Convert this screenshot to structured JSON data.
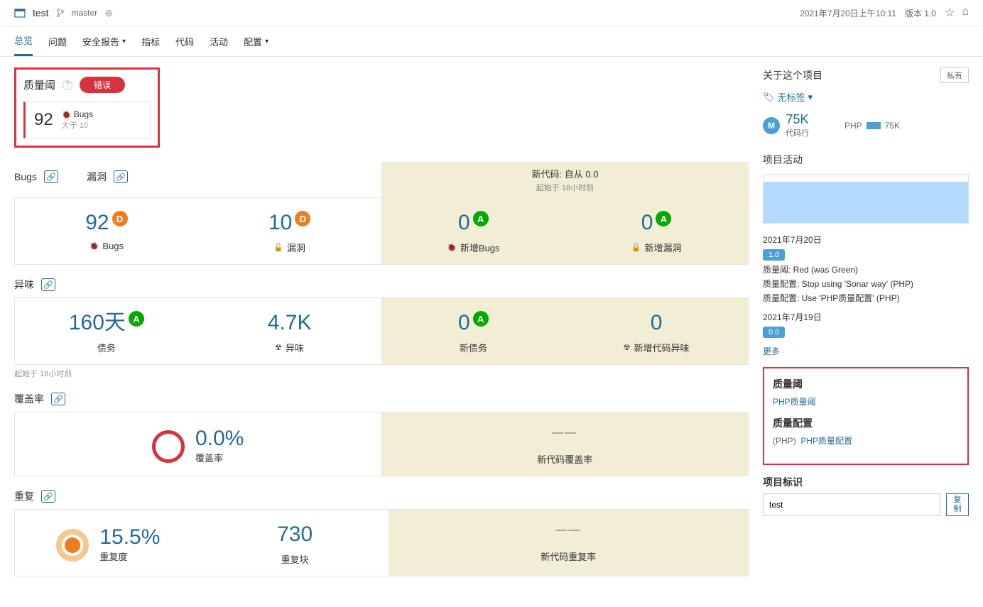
{
  "header": {
    "project_name": "test",
    "branch": "master",
    "timestamp": "2021年7月20日上午10:11",
    "version": "版本 1.0"
  },
  "tabs": {
    "overview": "总览",
    "issues": "问题",
    "security": "安全报告",
    "metrics": "指标",
    "code": "代码",
    "activity": "活动",
    "config": "配置"
  },
  "quality_gate": {
    "title": "质量阈",
    "status": "错误",
    "count": "92",
    "metric_label": "Bugs",
    "condition": "大于 10"
  },
  "sections": {
    "bugs": "Bugs",
    "vulnerabilities": "漏洞",
    "smells": "异味",
    "coverage": "覆盖率",
    "duplication": "重复"
  },
  "newcode": {
    "title": "新代码: 自从 0.0",
    "since": "起始于 18小时前"
  },
  "metrics": {
    "bugs": {
      "value": "92",
      "rating": "D",
      "label": "Bugs"
    },
    "vulnerabilities": {
      "value": "10",
      "rating": "D",
      "label": "漏洞"
    },
    "new_bugs": {
      "value": "0",
      "rating": "A",
      "label": "新增Bugs"
    },
    "new_vulnerabilities": {
      "value": "0",
      "rating": "A",
      "label": "新增漏洞"
    },
    "debt": {
      "value": "160天",
      "rating": "A",
      "label": "债务"
    },
    "smells": {
      "value": "4.7K",
      "label": "异味"
    },
    "new_debt": {
      "value": "0",
      "rating": "A",
      "label": "新债务"
    },
    "new_smells": {
      "value": "0",
      "label": "新增代码异味"
    },
    "coverage": {
      "value": "0.0%",
      "label": "覆盖率"
    },
    "new_coverage": {
      "label": "新代码覆盖率"
    },
    "duplication": {
      "value": "15.5%",
      "label": "重复度"
    },
    "dup_blocks": {
      "value": "730",
      "label": "重复块"
    },
    "new_duplication": {
      "label": "新代码重复率"
    }
  },
  "debt_since": "起始于 18小时前",
  "sidebar": {
    "about_title": "关于这个项目",
    "private": "私有",
    "no_tags": "无标签",
    "size": {
      "badge": "M",
      "value": "75K",
      "label": "代码行"
    },
    "lang": {
      "name": "PHP",
      "value": "75K"
    },
    "activity_title": "项目活动",
    "activity1": {
      "date": "2021年7月20日",
      "version": "1.0",
      "items": [
        "质量阈: Red (was Green)",
        "质量配置: Stop using 'Sonar way' (PHP)",
        "质量配置: Use 'PHP质量配置' (PHP)"
      ]
    },
    "activity2": {
      "date": "2021年7月19日",
      "version": "0.0"
    },
    "more": "更多",
    "qg_title": "质量阈",
    "qg_link": "PHP质量阈",
    "qp_title": "质量配置",
    "qp_lang": "(PHP)",
    "qp_link": "PHP质量配置",
    "project_id_title": "项目标识",
    "project_id": "test",
    "copy": "复制"
  }
}
